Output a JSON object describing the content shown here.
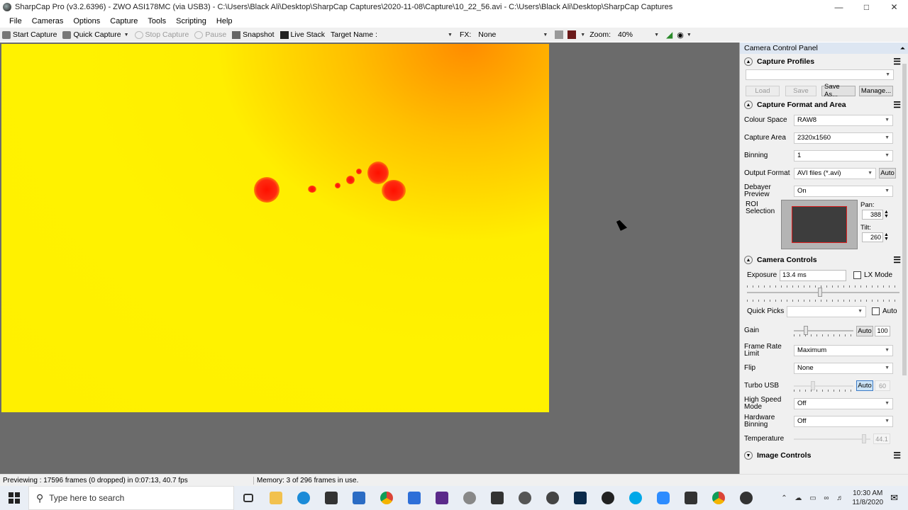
{
  "window": {
    "title": "SharpCap Pro (v3.2.6396) - ZWO ASI178MC (via USB3) - C:\\Users\\Black Ali\\Desktop\\SharpCap Captures\\2020-11-08\\Capture\\10_22_56.avi - C:\\Users\\Black Ali\\Desktop\\SharpCap Captures"
  },
  "menu": [
    "File",
    "Cameras",
    "Options",
    "Capture",
    "Tools",
    "Scripting",
    "Help"
  ],
  "toolbar": {
    "start_capture": "Start Capture",
    "quick_capture": "Quick Capture",
    "stop_capture": "Stop Capture",
    "pause": "Pause",
    "snapshot": "Snapshot",
    "live_stack": "Live Stack",
    "target_name_label": "Target Name :",
    "fx_label": "FX:",
    "fx_value": "None",
    "zoom_label": "Zoom:",
    "zoom_value": "40%"
  },
  "panel": {
    "title": "Camera Control Panel",
    "capture_profiles": {
      "header": "Capture Profiles",
      "load": "Load",
      "save": "Save",
      "save_as": "Save As...",
      "manage": "Manage..."
    },
    "format": {
      "header": "Capture Format and Area",
      "colour_space_label": "Colour Space",
      "colour_space": "RAW8",
      "capture_area_label": "Capture Area",
      "capture_area": "2320x1560",
      "binning_label": "Binning",
      "binning": "1",
      "output_format_label": "Output Format",
      "output_format": "AVI files (*.avi)",
      "auto": "Auto",
      "debayer_label": "Debayer Preview",
      "debayer": "On",
      "roi_label": "ROI Selection",
      "pan_label": "Pan:",
      "pan": "388",
      "tilt_label": "Tilt:",
      "tilt": "260"
    },
    "camera_controls": {
      "header": "Camera Controls",
      "exposure_label": "Exposure",
      "exposure": "13.4 ms",
      "lx_mode": "LX Mode",
      "quick_picks_label": "Quick Picks",
      "auto": "Auto",
      "gain_label": "Gain",
      "gain": "100",
      "frame_rate_label": "Frame Rate Limit",
      "frame_rate": "Maximum",
      "flip_label": "Flip",
      "flip": "None",
      "turbo_label": "Turbo USB",
      "turbo": "60",
      "high_speed_label": "High Speed Mode",
      "high_speed": "Off",
      "hw_binning_label": "Hardware Binning",
      "hw_binning": "Off",
      "temperature_label": "Temperature",
      "temperature": "44.1"
    },
    "image_controls": {
      "header": "Image Controls"
    }
  },
  "status": {
    "preview": "Previewing : 17596 frames (0 dropped) in 0:07:13, 40.7 fps",
    "memory": "Memory: 3 of 296 frames in use."
  },
  "taskbar": {
    "search_placeholder": "Type here to search",
    "time": "10:30 AM",
    "date": "11/8/2020"
  }
}
